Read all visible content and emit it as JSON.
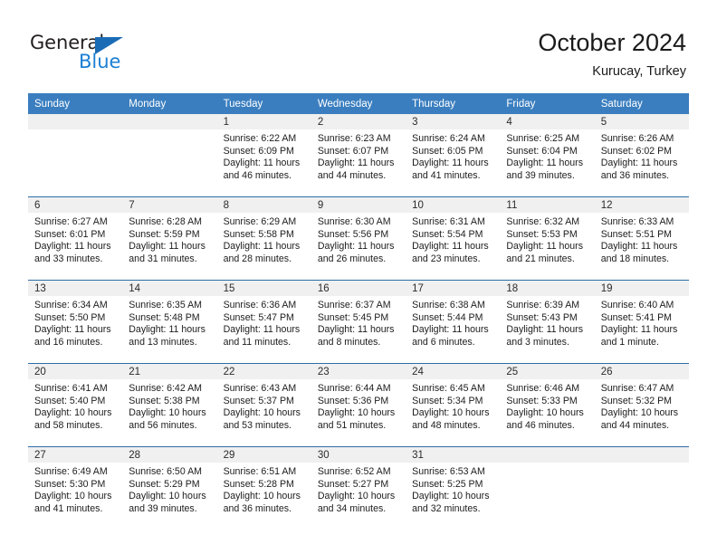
{
  "brand": {
    "name_top": "General",
    "name_bottom": "Blue",
    "triangle_icon": "triangle-icon",
    "color_dark": "#231f20",
    "color_blue": "#1b7fd4"
  },
  "header": {
    "title": "October 2024",
    "subtitle": "Kurucay, Turkey"
  },
  "theme": {
    "header_bg": "#3a7ebf",
    "week_divider": "#2e6da8",
    "daynum_band": "#f0f0f0"
  },
  "weekdays": [
    "Sunday",
    "Monday",
    "Tuesday",
    "Wednesday",
    "Thursday",
    "Friday",
    "Saturday"
  ],
  "weeks": [
    [
      {
        "day": "",
        "sunrise": "",
        "sunset": "",
        "daylight1": "",
        "daylight2": "",
        "empty": true
      },
      {
        "day": "",
        "sunrise": "",
        "sunset": "",
        "daylight1": "",
        "daylight2": "",
        "empty": true
      },
      {
        "day": "1",
        "sunrise": "Sunrise: 6:22 AM",
        "sunset": "Sunset: 6:09 PM",
        "daylight1": "Daylight: 11 hours",
        "daylight2": "and 46 minutes."
      },
      {
        "day": "2",
        "sunrise": "Sunrise: 6:23 AM",
        "sunset": "Sunset: 6:07 PM",
        "daylight1": "Daylight: 11 hours",
        "daylight2": "and 44 minutes."
      },
      {
        "day": "3",
        "sunrise": "Sunrise: 6:24 AM",
        "sunset": "Sunset: 6:05 PM",
        "daylight1": "Daylight: 11 hours",
        "daylight2": "and 41 minutes."
      },
      {
        "day": "4",
        "sunrise": "Sunrise: 6:25 AM",
        "sunset": "Sunset: 6:04 PM",
        "daylight1": "Daylight: 11 hours",
        "daylight2": "and 39 minutes."
      },
      {
        "day": "5",
        "sunrise": "Sunrise: 6:26 AM",
        "sunset": "Sunset: 6:02 PM",
        "daylight1": "Daylight: 11 hours",
        "daylight2": "and 36 minutes."
      }
    ],
    [
      {
        "day": "6",
        "sunrise": "Sunrise: 6:27 AM",
        "sunset": "Sunset: 6:01 PM",
        "daylight1": "Daylight: 11 hours",
        "daylight2": "and 33 minutes."
      },
      {
        "day": "7",
        "sunrise": "Sunrise: 6:28 AM",
        "sunset": "Sunset: 5:59 PM",
        "daylight1": "Daylight: 11 hours",
        "daylight2": "and 31 minutes."
      },
      {
        "day": "8",
        "sunrise": "Sunrise: 6:29 AM",
        "sunset": "Sunset: 5:58 PM",
        "daylight1": "Daylight: 11 hours",
        "daylight2": "and 28 minutes."
      },
      {
        "day": "9",
        "sunrise": "Sunrise: 6:30 AM",
        "sunset": "Sunset: 5:56 PM",
        "daylight1": "Daylight: 11 hours",
        "daylight2": "and 26 minutes."
      },
      {
        "day": "10",
        "sunrise": "Sunrise: 6:31 AM",
        "sunset": "Sunset: 5:54 PM",
        "daylight1": "Daylight: 11 hours",
        "daylight2": "and 23 minutes."
      },
      {
        "day": "11",
        "sunrise": "Sunrise: 6:32 AM",
        "sunset": "Sunset: 5:53 PM",
        "daylight1": "Daylight: 11 hours",
        "daylight2": "and 21 minutes."
      },
      {
        "day": "12",
        "sunrise": "Sunrise: 6:33 AM",
        "sunset": "Sunset: 5:51 PM",
        "daylight1": "Daylight: 11 hours",
        "daylight2": "and 18 minutes."
      }
    ],
    [
      {
        "day": "13",
        "sunrise": "Sunrise: 6:34 AM",
        "sunset": "Sunset: 5:50 PM",
        "daylight1": "Daylight: 11 hours",
        "daylight2": "and 16 minutes."
      },
      {
        "day": "14",
        "sunrise": "Sunrise: 6:35 AM",
        "sunset": "Sunset: 5:48 PM",
        "daylight1": "Daylight: 11 hours",
        "daylight2": "and 13 minutes."
      },
      {
        "day": "15",
        "sunrise": "Sunrise: 6:36 AM",
        "sunset": "Sunset: 5:47 PM",
        "daylight1": "Daylight: 11 hours",
        "daylight2": "and 11 minutes."
      },
      {
        "day": "16",
        "sunrise": "Sunrise: 6:37 AM",
        "sunset": "Sunset: 5:45 PM",
        "daylight1": "Daylight: 11 hours",
        "daylight2": "and 8 minutes."
      },
      {
        "day": "17",
        "sunrise": "Sunrise: 6:38 AM",
        "sunset": "Sunset: 5:44 PM",
        "daylight1": "Daylight: 11 hours",
        "daylight2": "and 6 minutes."
      },
      {
        "day": "18",
        "sunrise": "Sunrise: 6:39 AM",
        "sunset": "Sunset: 5:43 PM",
        "daylight1": "Daylight: 11 hours",
        "daylight2": "and 3 minutes."
      },
      {
        "day": "19",
        "sunrise": "Sunrise: 6:40 AM",
        "sunset": "Sunset: 5:41 PM",
        "daylight1": "Daylight: 11 hours",
        "daylight2": "and 1 minute."
      }
    ],
    [
      {
        "day": "20",
        "sunrise": "Sunrise: 6:41 AM",
        "sunset": "Sunset: 5:40 PM",
        "daylight1": "Daylight: 10 hours",
        "daylight2": "and 58 minutes."
      },
      {
        "day": "21",
        "sunrise": "Sunrise: 6:42 AM",
        "sunset": "Sunset: 5:38 PM",
        "daylight1": "Daylight: 10 hours",
        "daylight2": "and 56 minutes."
      },
      {
        "day": "22",
        "sunrise": "Sunrise: 6:43 AM",
        "sunset": "Sunset: 5:37 PM",
        "daylight1": "Daylight: 10 hours",
        "daylight2": "and 53 minutes."
      },
      {
        "day": "23",
        "sunrise": "Sunrise: 6:44 AM",
        "sunset": "Sunset: 5:36 PM",
        "daylight1": "Daylight: 10 hours",
        "daylight2": "and 51 minutes."
      },
      {
        "day": "24",
        "sunrise": "Sunrise: 6:45 AM",
        "sunset": "Sunset: 5:34 PM",
        "daylight1": "Daylight: 10 hours",
        "daylight2": "and 48 minutes."
      },
      {
        "day": "25",
        "sunrise": "Sunrise: 6:46 AM",
        "sunset": "Sunset: 5:33 PM",
        "daylight1": "Daylight: 10 hours",
        "daylight2": "and 46 minutes."
      },
      {
        "day": "26",
        "sunrise": "Sunrise: 6:47 AM",
        "sunset": "Sunset: 5:32 PM",
        "daylight1": "Daylight: 10 hours",
        "daylight2": "and 44 minutes."
      }
    ],
    [
      {
        "day": "27",
        "sunrise": "Sunrise: 6:49 AM",
        "sunset": "Sunset: 5:30 PM",
        "daylight1": "Daylight: 10 hours",
        "daylight2": "and 41 minutes."
      },
      {
        "day": "28",
        "sunrise": "Sunrise: 6:50 AM",
        "sunset": "Sunset: 5:29 PM",
        "daylight1": "Daylight: 10 hours",
        "daylight2": "and 39 minutes."
      },
      {
        "day": "29",
        "sunrise": "Sunrise: 6:51 AM",
        "sunset": "Sunset: 5:28 PM",
        "daylight1": "Daylight: 10 hours",
        "daylight2": "and 36 minutes."
      },
      {
        "day": "30",
        "sunrise": "Sunrise: 6:52 AM",
        "sunset": "Sunset: 5:27 PM",
        "daylight1": "Daylight: 10 hours",
        "daylight2": "and 34 minutes."
      },
      {
        "day": "31",
        "sunrise": "Sunrise: 6:53 AM",
        "sunset": "Sunset: 5:25 PM",
        "daylight1": "Daylight: 10 hours",
        "daylight2": "and 32 minutes."
      },
      {
        "day": "",
        "sunrise": "",
        "sunset": "",
        "daylight1": "",
        "daylight2": "",
        "empty": true
      },
      {
        "day": "",
        "sunrise": "",
        "sunset": "",
        "daylight1": "",
        "daylight2": "",
        "empty": true
      }
    ]
  ]
}
